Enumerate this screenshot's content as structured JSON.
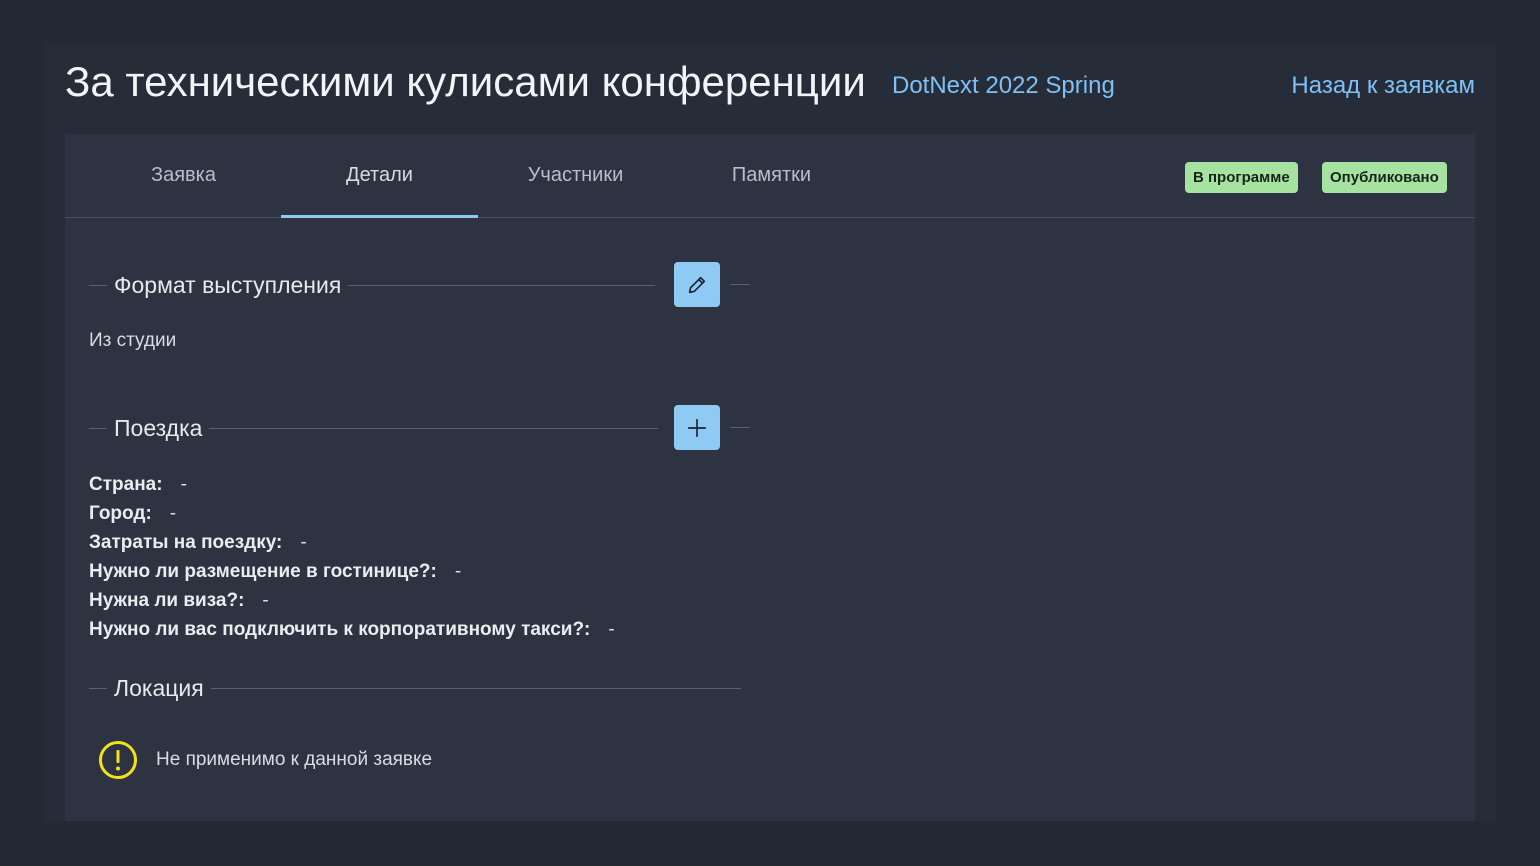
{
  "header": {
    "title": "За техническими кулисами конференции",
    "conference": "DotNext 2022 Spring",
    "back_link": "Назад к заявкам"
  },
  "tabs": [
    {
      "label": "Заявка",
      "active": false
    },
    {
      "label": "Детали",
      "active": true
    },
    {
      "label": "Участники",
      "active": false
    },
    {
      "label": "Памятки",
      "active": false
    }
  ],
  "badges": {
    "in_program": "В программе",
    "published": "Опубликовано"
  },
  "sections": {
    "format": {
      "title": "Формат выступления",
      "value": "Из студии",
      "action_icon": "pencil-icon"
    },
    "trip": {
      "title": "Поездка",
      "action_icon": "plus-icon",
      "fields": [
        {
          "label": "Страна:",
          "value": "-"
        },
        {
          "label": "Город:",
          "value": "-"
        },
        {
          "label": "Затраты на поездку:",
          "value": "-"
        },
        {
          "label": "Нужно ли размещение в гостинице?:",
          "value": "-"
        },
        {
          "label": "Нужна ли виза?:",
          "value": "-"
        },
        {
          "label": "Нужно ли вас подключить к корпоративному такси?:",
          "value": "-"
        }
      ]
    },
    "location": {
      "title": "Локация",
      "notice_icon": "warning-circle-icon",
      "notice": "Не применимо к данной заявке"
    }
  },
  "colors": {
    "accent": "#8fcaf5",
    "link": "#7fc0f5",
    "badge_bg": "#a6e3a1",
    "warning": "#f5e11b",
    "panel_bg": "#2d3340",
    "page_bg": "#232a35"
  }
}
